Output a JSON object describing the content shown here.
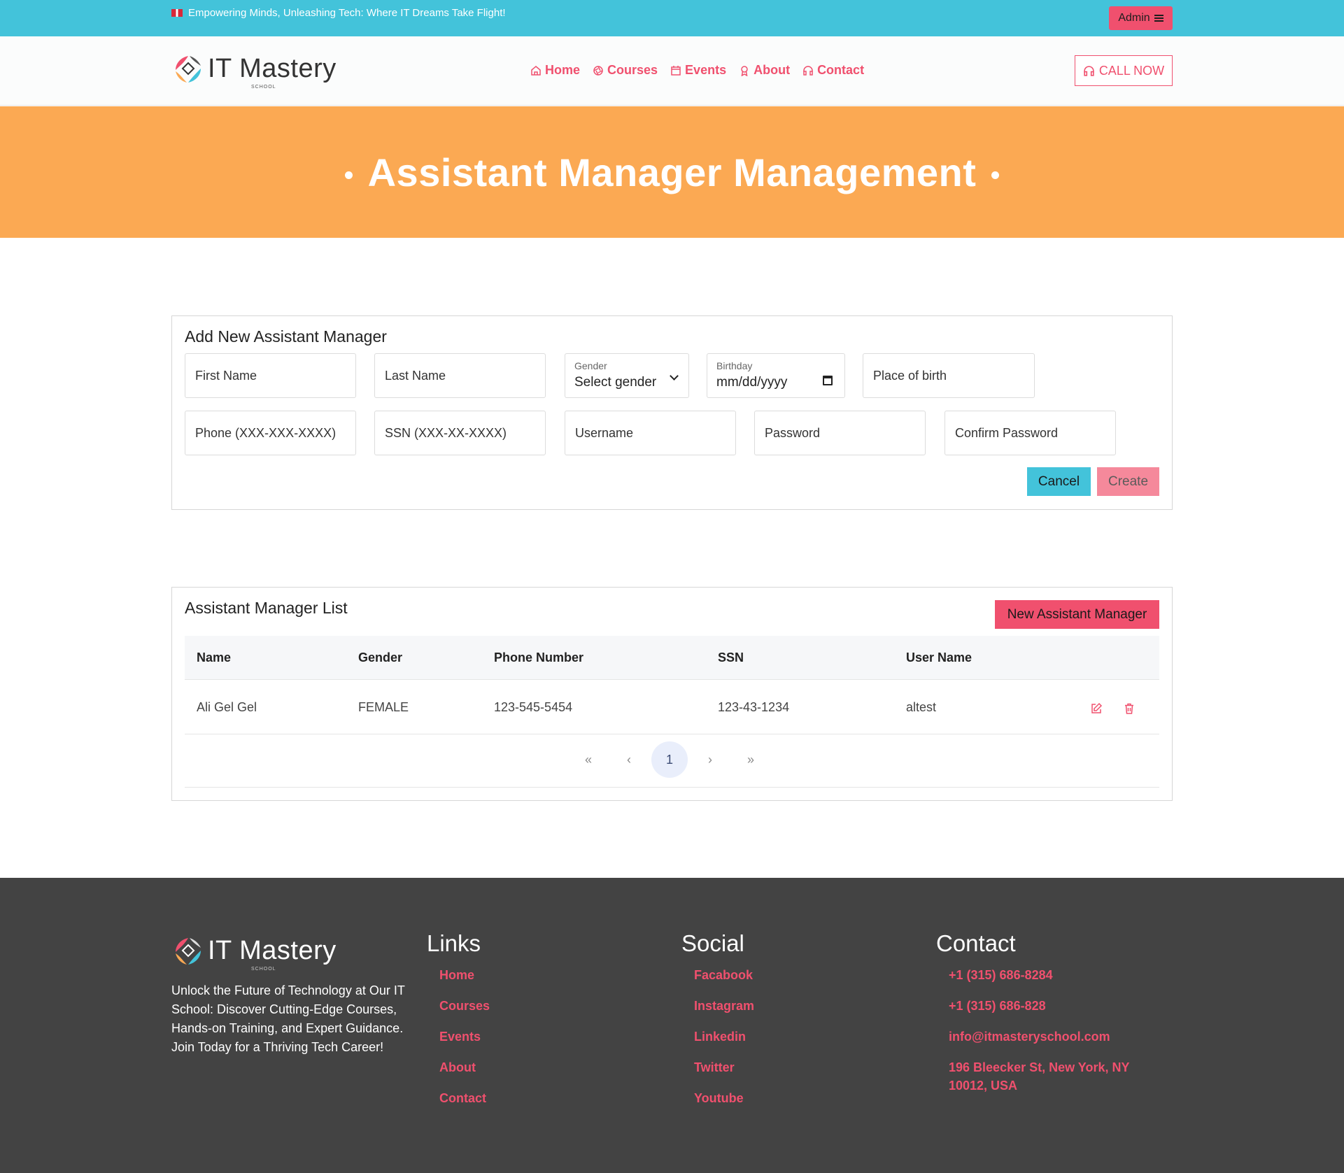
{
  "topbar": {
    "tagline": "Empowering Minds, Unleashing Tech: Where IT Dreams Take Flight!",
    "admin_label": "Admin"
  },
  "brand": {
    "name": "IT Mastery",
    "sub": "SCHOOL"
  },
  "nav": {
    "home": "Home",
    "courses": "Courses",
    "events": "Events",
    "about": "About",
    "contact": "Contact",
    "call_now": "CALL NOW"
  },
  "hero": {
    "title": "Assistant Manager Management"
  },
  "form": {
    "title": "Add New Assistant Manager",
    "first_name_placeholder": "First Name",
    "last_name_placeholder": "Last Name",
    "gender_label": "Gender",
    "gender_value": "Select gender",
    "birthday_label": "Birthday",
    "birthday_value": "mm/dd/yyyy",
    "place_of_birth_placeholder": "Place of birth",
    "phone_placeholder": "Phone (XXX-XXX-XXXX)",
    "ssn_placeholder": "SSN (XXX-XX-XXXX)",
    "username_placeholder": "Username",
    "password_placeholder": "Password",
    "confirm_password_placeholder": "Confirm Password",
    "cancel_label": "Cancel",
    "create_label": "Create"
  },
  "list": {
    "title": "Assistant Manager List",
    "new_button": "New Assistant Manager",
    "columns": [
      "Name",
      "Gender",
      "Phone Number",
      "SSN",
      "User Name"
    ],
    "rows": [
      {
        "name": "Ali Gel Gel",
        "gender": "FEMALE",
        "phone": "123-545-5454",
        "ssn": "123-43-1234",
        "username": "altest"
      }
    ],
    "pagination": {
      "first": "«",
      "prev": "‹",
      "current": "1",
      "next": "›",
      "last": "»"
    }
  },
  "footer": {
    "about": "Unlock the Future of Technology at Our IT School: Discover Cutting-Edge Courses, Hands-on Training, and Expert Guidance. Join Today for a Thriving Tech Career!",
    "links_title": "Links",
    "links": [
      "Home",
      "Courses",
      "Events",
      "About",
      "Contact"
    ],
    "social_title": "Social",
    "social": [
      "Facabook",
      "Instagram",
      "Linkedin",
      "Twitter",
      "Youtube"
    ],
    "contact_title": "Contact",
    "contact": [
      "+1 (315) 686-8284",
      "+1 (315) 686-828",
      "info@itmasteryschool.com",
      "196 Bleecker St, New York, NY 10012, USA"
    ]
  },
  "colors": {
    "topbar": "#43c3da",
    "accent": "#f0506e",
    "hero": "#fba953",
    "footer": "#434343"
  }
}
